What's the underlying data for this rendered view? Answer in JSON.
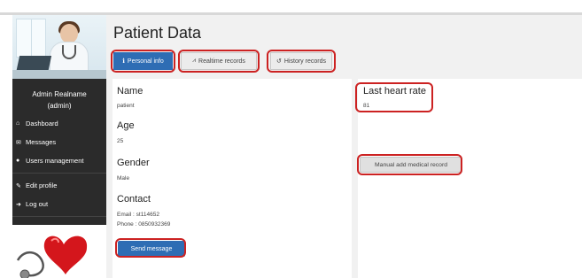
{
  "page_title": "Patient Data",
  "sidebar": {
    "user_name": "Admin Realname",
    "user_role": "(admin)",
    "items": [
      {
        "label": "Dashboard",
        "icon": "home-icon"
      },
      {
        "label": "Messages",
        "icon": "envelope-icon"
      },
      {
        "label": "Users management",
        "icon": "users-icon"
      },
      {
        "label": "Edit profile",
        "icon": "wrench-icon"
      },
      {
        "label": "Log out",
        "icon": "logout-icon"
      }
    ]
  },
  "tabs": [
    {
      "label": "Personal info",
      "icon": "info-icon",
      "active": true
    },
    {
      "label": "Realtime records",
      "icon": "line-chart-icon",
      "active": false
    },
    {
      "label": "History records",
      "icon": "history-icon",
      "active": false
    }
  ],
  "personal": {
    "name_label": "Name",
    "name_value": "patient",
    "age_label": "Age",
    "age_value": "25",
    "gender_label": "Gender",
    "gender_value": "Male",
    "contact_label": "Contact",
    "email_line": "Email : st114652",
    "phone_line": "Phone : 0850932369",
    "send_button": "Send message"
  },
  "heart": {
    "label": "Last heart rate",
    "value": "81",
    "manual_button": "Manual add medical record"
  },
  "colors": {
    "sidebar_bg": "#2b2b2b",
    "primary": "#2e6db4",
    "highlight": "#cc2222"
  }
}
